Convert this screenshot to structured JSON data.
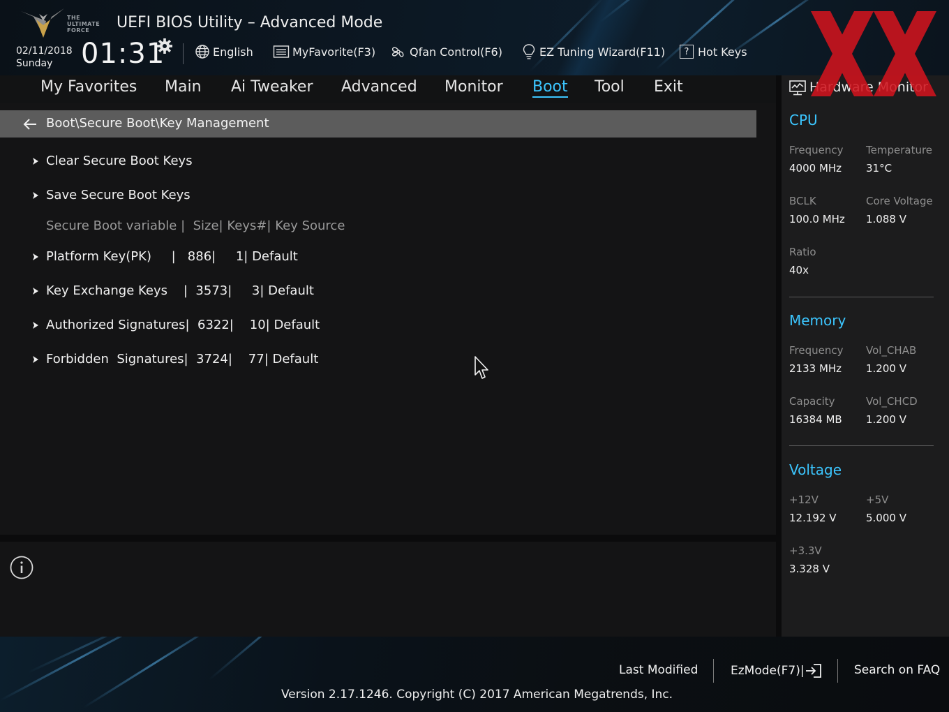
{
  "header": {
    "title": "UEFI BIOS Utility – Advanced Mode",
    "logo_lines": [
      "THE",
      "ULTIMATE",
      "FORCE"
    ],
    "date": "02/11/2018",
    "day": "Sunday",
    "time": "01:31",
    "language": "English",
    "my_favorite": "MyFavorite(F3)",
    "qfan": "Qfan Control(F6)",
    "ez_tuning": "EZ Tuning Wizard(F11)",
    "hotkey_glyph": "?",
    "hot_keys": "Hot Keys"
  },
  "nav": {
    "tabs": [
      {
        "label": "My Favorites"
      },
      {
        "label": "Main"
      },
      {
        "label": "Ai Tweaker"
      },
      {
        "label": "Advanced"
      },
      {
        "label": "Monitor"
      },
      {
        "label": "Boot"
      },
      {
        "label": "Tool"
      },
      {
        "label": "Exit"
      }
    ],
    "active": "Boot",
    "accent_color": "#3cc6ff"
  },
  "main": {
    "breadcrumb": "Boot\\Secure Boot\\Key Management",
    "items": [
      {
        "label": "Clear Secure Boot Keys"
      },
      {
        "label": "Save Secure Boot Keys"
      }
    ],
    "table_header": "Secure Boot variable |  Size| Keys#| Key Source",
    "keys": [
      {
        "label": "Platform Key(PK)     |   886|     1| Default"
      },
      {
        "label": "Key Exchange Keys    |  3573|     3| Default"
      },
      {
        "label": "Authorized Signatures|  6322|    10| Default"
      },
      {
        "label": "Forbidden  Signatures|  3724|    77| Default"
      }
    ]
  },
  "hardware_monitor": {
    "title": "Hardware Monitor",
    "cpu": {
      "title": "CPU",
      "frequency_label": "Frequency",
      "frequency_value": "4000 MHz",
      "temperature_label": "Temperature",
      "temperature_value": "31°C",
      "bclk_label": "BCLK",
      "bclk_value": "100.0 MHz",
      "core_voltage_label": "Core Voltage",
      "core_voltage_value": "1.088 V",
      "ratio_label": "Ratio",
      "ratio_value": "40x"
    },
    "memory": {
      "title": "Memory",
      "frequency_label": "Frequency",
      "frequency_value": "2133 MHz",
      "vol_chab_label": "Vol_CHAB",
      "vol_chab_value": "1.200 V",
      "capacity_label": "Capacity",
      "capacity_value": "16384 MB",
      "vol_chcd_label": "Vol_CHCD",
      "vol_chcd_value": "1.200 V"
    },
    "voltage": {
      "title": "Voltage",
      "v12_label": "+12V",
      "v12_value": "12.192 V",
      "v5_label": "+5V",
      "v5_value": "5.000 V",
      "v33_label": "+3.3V",
      "v33_value": "3.328 V"
    }
  },
  "footer": {
    "last_modified": "Last Modified",
    "ezmode": "EzMode(F7)|",
    "search_faq": "Search on FAQ",
    "version": "Version 2.17.1246. Copyright (C) 2017 American Megatrends, Inc."
  },
  "icons": {
    "logo": "tuf-shield-icon",
    "gear": "gear-icon",
    "language": "globe-icon",
    "favorite": "list-icon",
    "qfan": "fan-icon",
    "ez_tuning": "lightbulb-icon",
    "hot_keys": "help-box-icon",
    "back": "arrow-left-icon",
    "submenu": "chevron-right-icon",
    "info": "info-icon",
    "monitor": "monitor-icon",
    "ezmode": "exit-icon",
    "cursor": "mouse-cursor-icon"
  }
}
